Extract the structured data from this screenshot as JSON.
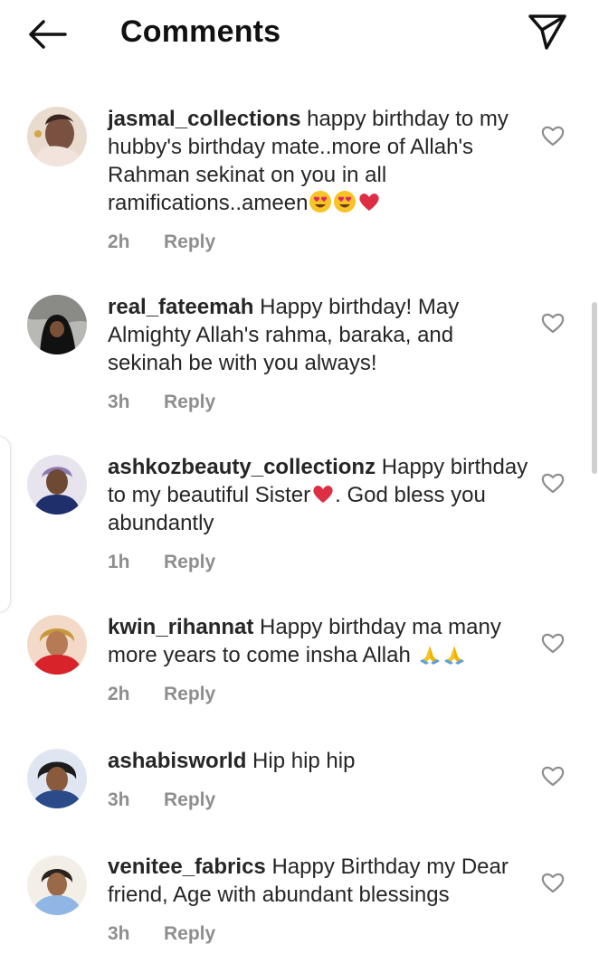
{
  "header": {
    "title": "Comments",
    "back_icon": "arrow-left-icon",
    "share_icon": "paper-plane-icon"
  },
  "comments": [
    {
      "username": "jasmal_collections",
      "text": "happy birthday to my hubby's birthday mate..more of Allah's Rahman sekinat on you in all ramifications..ameen",
      "emojis": [
        "heart-eyes",
        "heart-eyes",
        "red-heart"
      ],
      "time": "2h",
      "reply": "Reply",
      "avatar_color": "#6b4a3a"
    },
    {
      "username": "real_fateemah",
      "text": "Happy birthday! May Almighty Allah's rahma, baraka, and sekinah be with you always!",
      "emojis": [],
      "time": "3h",
      "reply": "Reply",
      "avatar_color": "#2a2a2a"
    },
    {
      "username": "ashkozbeauty_collectionz",
      "text": "Happy birthday to my beautiful Sister",
      "emojis": [
        "red-heart"
      ],
      "text_after": ". God bless you abundantly",
      "time": "1h",
      "reply": "Reply",
      "avatar_color": "#3b2f6b"
    },
    {
      "username": "kwin_rihannat",
      "text": "Happy birthday ma many more years to come insha Allah",
      "emojis": [
        "folded-hands",
        "folded-hands"
      ],
      "time": "2h",
      "reply": "Reply",
      "avatar_color": "#d23a3a"
    },
    {
      "username": "ashabisworld",
      "text": "Hip hip hip",
      "emojis": [],
      "time": "3h",
      "reply": "Reply",
      "avatar_color": "#1f3b73"
    },
    {
      "username": "venitee_fabrics",
      "text": "Happy Birthday my Dear friend, Age with abundant blessings",
      "emojis": [],
      "time": "3h",
      "reply": "Reply",
      "avatar_color": "#7ca6d6"
    }
  ],
  "like_icon": "heart-outline-icon"
}
